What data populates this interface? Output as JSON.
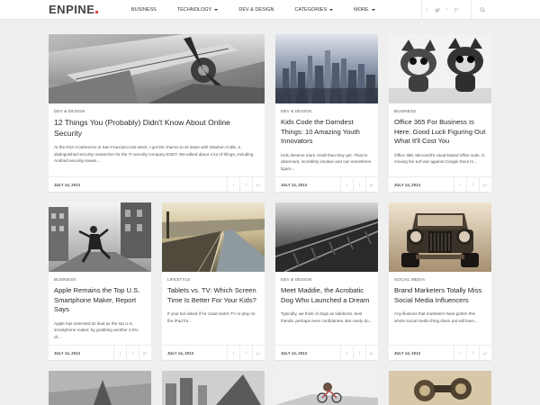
{
  "header": {
    "logo_main": "EN",
    "logo_rest": "PINE",
    "nav": [
      {
        "label": "BUSINESS",
        "dropdown": false
      },
      {
        "label": "TECHNOLOGY",
        "dropdown": true
      },
      {
        "label": "DEV & DESIGN",
        "dropdown": false
      },
      {
        "label": "CATEGORIES",
        "dropdown": true
      },
      {
        "label": "MORE",
        "dropdown": true
      }
    ],
    "social": [
      "tumblr-icon",
      "twitter-icon",
      "facebook-icon",
      "google-plus-icon"
    ],
    "search_icon": "search-icon",
    "accent_color": "#e2433b"
  },
  "share_icons": [
    "t",
    "f",
    "g+"
  ],
  "posts": [
    {
      "category": "DEV & DESIGN",
      "title": "12 Things You (Probably) Didn't Know About Online Security",
      "excerpt": "At the RSA Conference in San Francisco last week, I got the chance to sit down with Stephen Cobb, a distinguished security researcher for the IT security company ESET. We talked about a lot of things, including Android security issues...",
      "date": "JULY 14, 2013",
      "image": "airplane-propeller"
    },
    {
      "category": "DEV & DESIGN",
      "title": "Kids Code the Darndest Things: 10 Amazing Youth Innovators",
      "excerpt": "Kids deserve more credit than they get. They're observant, incredibly intuitive and can sometimes figure...",
      "date": "JULY 14, 2013",
      "image": "city-skyline"
    },
    {
      "category": "BUSINESS",
      "title": "Office 365 For Business Is Here. Good Luck Figuring Out What It'll Cost You",
      "excerpt": "Office 365, Microsoft's cloud-based office suite, is moving the turf war against Google Docs to...",
      "date": "JULY 14, 2013",
      "image": "toy-figurines"
    },
    {
      "category": "BUSINESS",
      "title": "Apple Remains the Top U.S. Smartphone Maker, Report Says",
      "excerpt": "Apple has extended its lead as the top U.S. smartphone-maker, by grabbing another 3.5% of...",
      "date": "JULY 14, 2013",
      "image": "running-businessman"
    },
    {
      "category": "LIFESTYLE",
      "title": "Tablets vs. TV: Which Screen Time Is Better For Your Kids?",
      "excerpt": "If your kid asked if he could watch TV or play on the iPad for...",
      "date": "JULY 14, 2013",
      "image": "coastal-road"
    },
    {
      "category": "DEV & DESIGN",
      "title": "Meet Maddie, the Acrobatic Dog Who Launched a Dream",
      "excerpt": "Typically, we think of dogs as sidekicks, best friends, perhaps even confidantes. But rarely do...",
      "date": "JULY 14, 2013",
      "image": "railroad-tracks"
    },
    {
      "category": "SOCIAL MEDIA",
      "title": "Brand Marketers Totally Miss Social Media Influencers",
      "excerpt": "Any illusions that marketers have gotten this whole social media thing down pat will have...",
      "date": "JULY 14, 2013",
      "image": "vintage-car"
    }
  ]
}
